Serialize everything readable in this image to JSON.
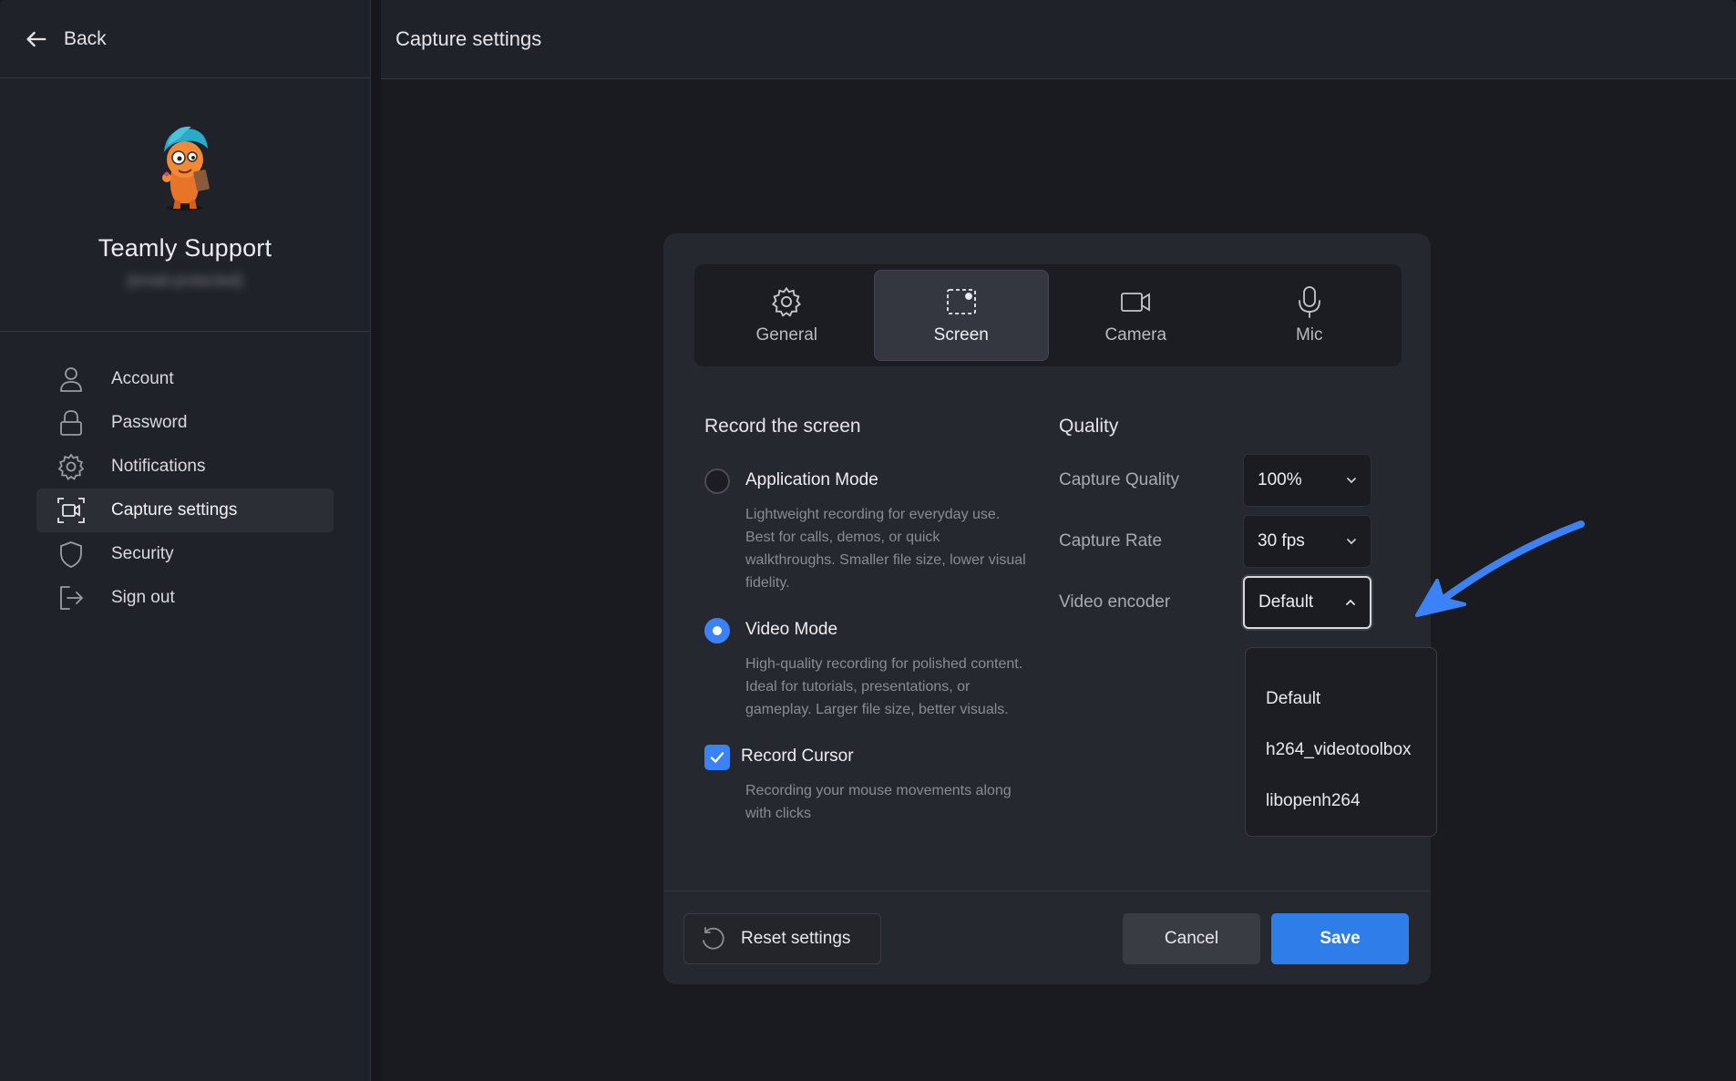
{
  "sidebar": {
    "back_label": "Back",
    "profile": {
      "name": "Teamly Support",
      "email": "[email protected]"
    },
    "nav": [
      {
        "label": "Account",
        "icon": "user-icon"
      },
      {
        "label": "Password",
        "icon": "lock-icon"
      },
      {
        "label": "Notifications",
        "icon": "gear-icon"
      },
      {
        "label": "Capture settings",
        "icon": "capture-icon",
        "active": true
      },
      {
        "label": "Security",
        "icon": "shield-icon"
      },
      {
        "label": "Sign out",
        "icon": "sign-out-icon"
      }
    ]
  },
  "header": {
    "title": "Capture settings"
  },
  "dialog": {
    "tabs": [
      {
        "label": "General",
        "icon": "gear-icon"
      },
      {
        "label": "Screen",
        "icon": "screen-capture-icon",
        "active": true
      },
      {
        "label": "Camera",
        "icon": "camera-icon"
      },
      {
        "label": "Mic",
        "icon": "microphone-icon"
      }
    ],
    "record": {
      "title": "Record the screen",
      "app_mode": {
        "title": "Application Mode",
        "desc": "Lightweight recording for everyday use. Best for calls, demos, or quick walkthroughs. Smaller file size, lower visual fidelity.",
        "selected": false
      },
      "video_mode": {
        "title": "Video Mode",
        "desc": "High-quality recording for polished content. Ideal for tutorials, presentations, or gameplay. Larger file size, better visuals.",
        "selected": true
      },
      "cursor": {
        "title": "Record Cursor",
        "desc": "Recording your mouse movements along with clicks",
        "checked": true
      }
    },
    "quality": {
      "title": "Quality",
      "capture_quality": {
        "label": "Capture Quality",
        "value": "100%"
      },
      "capture_rate": {
        "label": "Capture Rate",
        "value": "30 fps"
      },
      "video_encoder": {
        "label": "Video encoder",
        "value": "Default",
        "options": [
          "Default",
          "h264_videotoolbox",
          "libopenh264"
        ]
      }
    },
    "footer": {
      "reset_label": "Reset settings",
      "cancel_label": "Cancel",
      "save_label": "Save"
    }
  },
  "colors": {
    "accent": "#2f7de9",
    "annotation_arrow": "#3b82f6"
  }
}
